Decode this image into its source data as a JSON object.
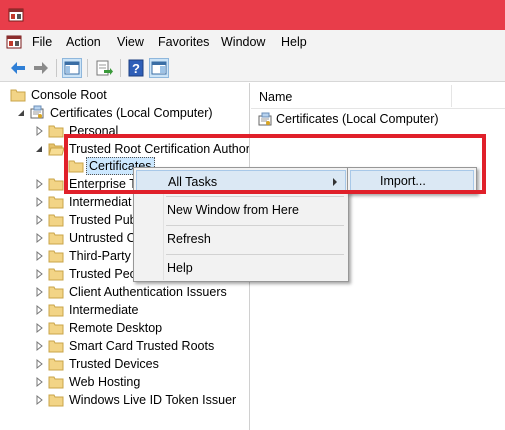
{
  "menubar": {
    "items": [
      "File",
      "Action",
      "View",
      "Favorites",
      "Window",
      "Help"
    ]
  },
  "toolbar": {
    "buttons": [
      "back-icon",
      "forward-icon",
      "show-hide-console-tree-icon",
      "export-list-icon",
      "help-icon",
      "action-pane-icon"
    ]
  },
  "tree": {
    "root": "Console Root",
    "certificates": "Certificates (Local Computer)",
    "personal": "Personal",
    "trusted_root": "Trusted Root Certification Author",
    "certificates_child": "Certificates",
    "enterprise": "Enterprise T",
    "intermediate_1": "Intermediat",
    "trusted_pub": "Trusted Pub",
    "untrusted": "Untrusted C",
    "third_party": "Third-Party",
    "trusted_peo": "Trusted Peo",
    "client_auth": "Client Authentication Issuers",
    "intermediate_2": "Intermediate",
    "remote_desktop": "Remote Desktop",
    "smart_card": "Smart Card Trusted Roots",
    "trusted_devices": "Trusted Devices",
    "web_hosting": "Web Hosting",
    "windows_live": "Windows Live ID Token Issuer"
  },
  "detail": {
    "column_name": "Name",
    "rows": [
      "Certificates (Local Computer)"
    ]
  },
  "context_menu": {
    "all_tasks": "All Tasks",
    "new_window": "New Window from Here",
    "refresh": "Refresh",
    "help": "Help"
  },
  "submenu": {
    "import": "Import..."
  },
  "colors": {
    "title_bar": "#e83d4a",
    "highlight_border": "#e0202a",
    "menu_hover": "#dbe8f4",
    "selection": "#cce8ff"
  }
}
